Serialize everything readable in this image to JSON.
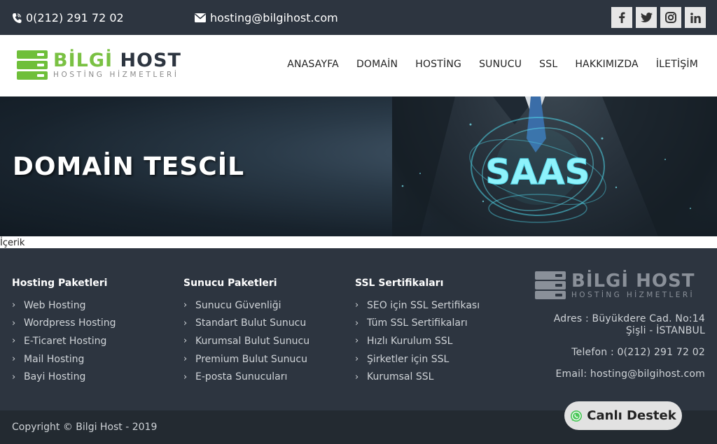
{
  "topbar": {
    "phone": "0(212) 291 72 02",
    "email": "hosting@bilgihost.com",
    "social": [
      "facebook-icon",
      "twitter-icon",
      "instagram-icon",
      "linkedin-icon"
    ]
  },
  "logo": {
    "brand_green": "BİLGİ",
    "brand_dark": "HOST",
    "tagline": "HOSTİNG HİZMETLERİ"
  },
  "nav": [
    "ANASAYFA",
    "DOMAİN",
    "HOSTİNG",
    "SUNUCU",
    "SSL",
    "HAKKIMIZDA",
    "İLETİŞİM"
  ],
  "hero": {
    "title": "DOMAİN TESCİL",
    "image_text": "SAAS"
  },
  "content_label": "İçerik",
  "footer": {
    "col1": {
      "title": "Hosting Paketleri",
      "items": [
        "Web Hosting",
        "Wordpress Hosting",
        "E-Ticaret Hosting",
        "Mail Hosting",
        "Bayi Hosting"
      ]
    },
    "col2": {
      "title": "Sunucu Paketleri",
      "items": [
        "Sunucu Güvenliği",
        "Standart Bulut Sunucu",
        "Kurumsal Bulut Sunucu",
        "Premium Bulut Sunucu",
        "E-posta Sunucuları"
      ]
    },
    "col3": {
      "title": "SSL Sertifikaları",
      "items": [
        "SEO için SSL Sertifikası",
        "Tüm SSL Sertifikaları",
        "Hızlı Kurulum SSL",
        "Şirketler için SSL",
        "Kurumsal SSL"
      ]
    },
    "logo": {
      "brand": "BİLGİ HOST",
      "tagline": "HOSTİNG HİZMETLERİ"
    },
    "address_line1": "Adres : Büyükdere Cad. No:14",
    "address_line2": "Şişli - İSTANBUL",
    "phone": "Telefon : 0(212) 291 72 02",
    "email": "Email: hosting@bilgihost.com",
    "copyright": "Copyright © Bilgi Host - 2019"
  },
  "live_support": {
    "label": "Canlı Destek"
  },
  "colors": {
    "dark": "#2d3540",
    "green": "#7ac143",
    "footer_bottom": "#232a31",
    "glow": "#4fd3e6"
  }
}
